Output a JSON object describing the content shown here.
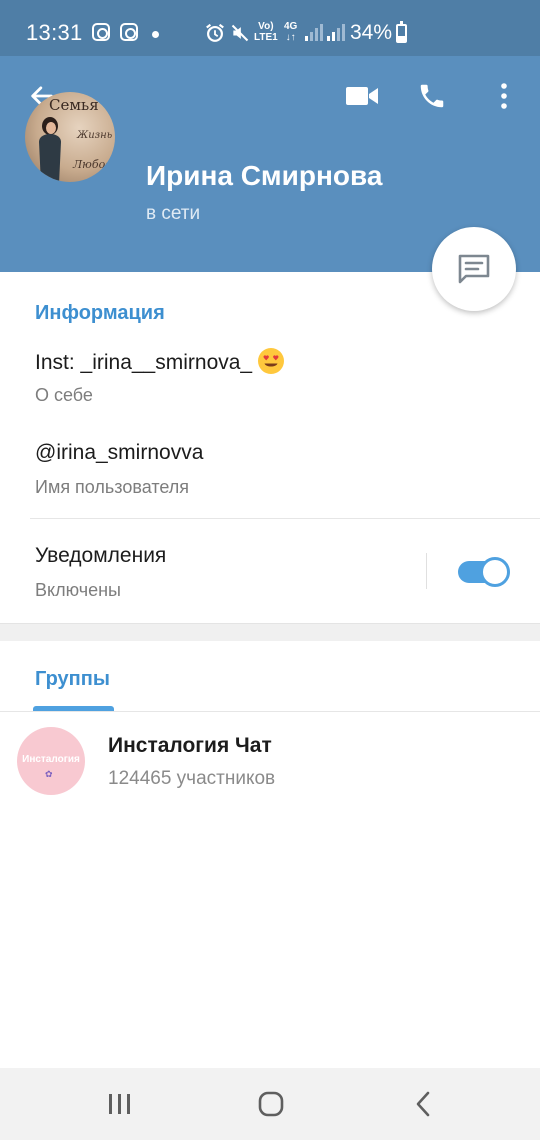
{
  "status_bar": {
    "time": "13:31",
    "volte": "Vo)\nLTE1",
    "network": "4G",
    "battery_percent": "34%",
    "battery_level": 0.34
  },
  "header": {
    "name": "Ирина Смирнова",
    "status": "в сети",
    "avatar_text": [
      "Семья",
      "Жизнь",
      "Любовь"
    ]
  },
  "info": {
    "section_title": "Информация",
    "bio_value": "Inst: _irina__smirnova_",
    "bio_label": "О себе",
    "username_value": "@irina_smirnovva",
    "username_label": "Имя пользователя",
    "notifications_value": "Уведомления",
    "notifications_label": "Включены",
    "notifications_on": true
  },
  "groups": {
    "tab_label": "Группы",
    "items": [
      {
        "name": "Инсталогия Чат",
        "members": "124465 участников",
        "avatar_text": "Инсталогия"
      }
    ]
  },
  "colors": {
    "header": "#5a8fbe",
    "status_bar": "#4f7ea6",
    "accent": "#3d8fd0"
  }
}
